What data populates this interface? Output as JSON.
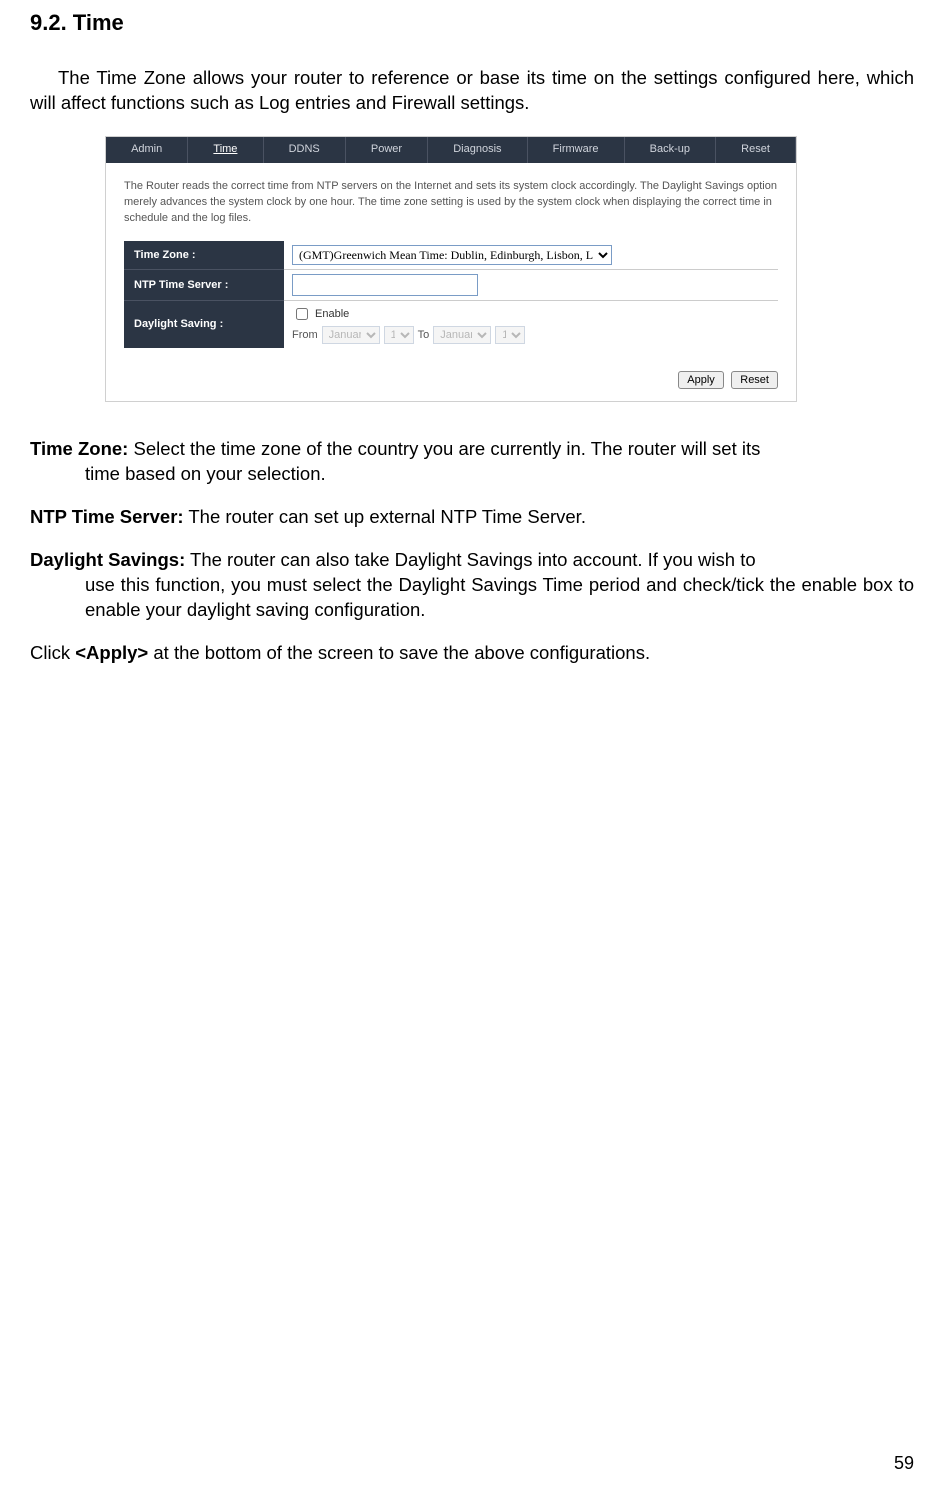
{
  "heading": "9.2. Time",
  "intro": "The Time Zone allows your router to reference or base its time on the settings configured here, which will affect functions such as Log entries and Firewall settings.",
  "screenshot": {
    "tabs": [
      "Admin",
      "Time",
      "DDNS",
      "Power",
      "Diagnosis",
      "Firmware",
      "Back-up",
      "Reset"
    ],
    "active_tab_index": 1,
    "description": "The Router reads the correct time from NTP servers on the Internet and sets its system clock accordingly. The Daylight Savings option merely advances the system clock by one hour. The time zone setting is used by the system clock when displaying the correct time in schedule and the log files.",
    "rows": {
      "timezone": {
        "label": "Time Zone :",
        "value": "(GMT)Greenwich Mean Time: Dublin, Edinburgh, Lisbon, London"
      },
      "ntp": {
        "label": "NTP Time Server :",
        "value": ""
      },
      "daylight": {
        "label": "Daylight Saving :",
        "enable_text": "Enable",
        "from_text": "From",
        "to_text": "To",
        "from_month": "January",
        "from_day": "1",
        "to_month": "January",
        "to_day": "1"
      }
    },
    "buttons": {
      "apply": "Apply",
      "reset": "Reset"
    }
  },
  "defs": {
    "tz_label": "Time Zone:",
    "tz_text_first": " Select the time zone of the country you are currently in. The router will set its",
    "tz_text_rest": "time based on your selection.",
    "ntp_label": "NTP Time Server:",
    "ntp_text": " The router can set up external NTP Time Server.",
    "ds_label": "Daylight Savings:",
    "ds_text_first": " The router can also take Daylight Savings into account. If you wish to",
    "ds_text_rest": "use this function, you must select the Daylight Savings Time period and check/tick the enable box to enable your daylight saving configuration."
  },
  "closing_pre": "Click ",
  "closing_bold": "<Apply>",
  "closing_post": " at the bottom of the screen to save the above configurations.",
  "page_number": "59"
}
